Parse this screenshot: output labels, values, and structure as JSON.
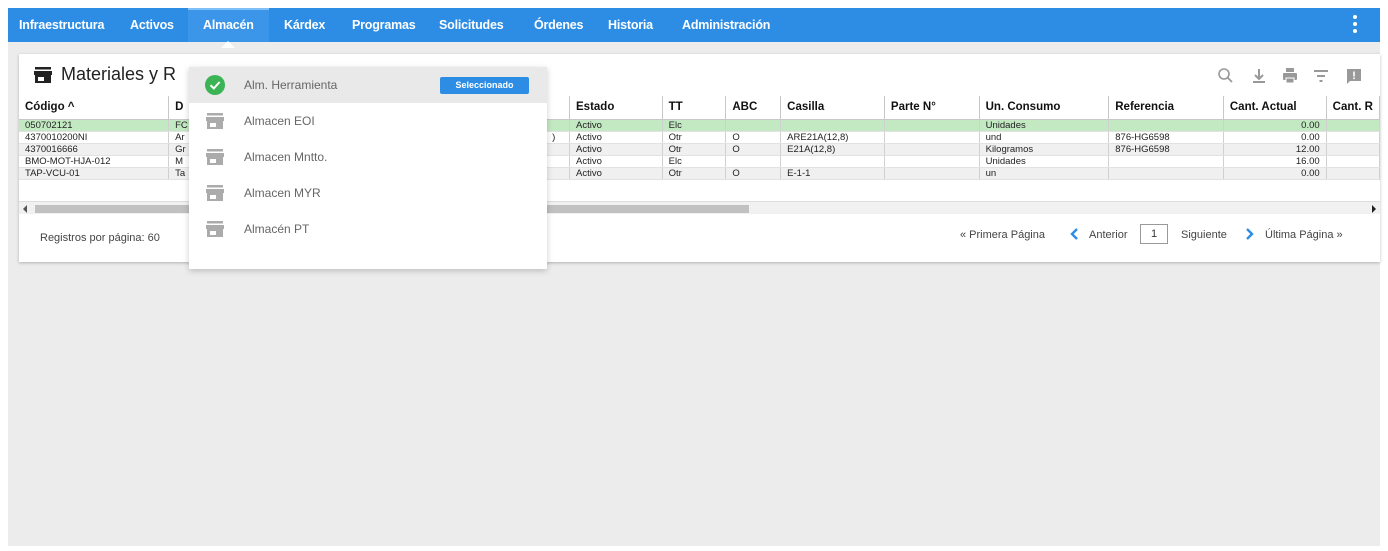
{
  "nav": {
    "items": [
      "Infraestructura",
      "Activos",
      "Almacén",
      "Kárdex",
      "Programas",
      "Solicitudes",
      "Órdenes",
      "Historia",
      "Administración"
    ],
    "active": "Almacén"
  },
  "card": {
    "title": "Materiales y R",
    "columns": [
      "Código ^",
      "D",
      "",
      "Estado",
      "TT",
      "ABC",
      "Casilla",
      "Parte N°",
      "Un. Consumo",
      "Referencia",
      "Cant. Actual",
      "Cant. R"
    ],
    "rows": [
      [
        "050702121",
        "FC",
        "",
        "Activo",
        "Elc",
        "",
        "",
        "",
        "Unidades",
        "",
        "0.00",
        ""
      ],
      [
        "4370010200NI",
        "Ar",
        ")",
        "Activo",
        "Otr",
        "O",
        "ARE21A(12,8)",
        "",
        "und",
        "876-HG6598",
        "0.00",
        ""
      ],
      [
        "4370016666",
        "Gr",
        "",
        "Activo",
        "Otr",
        "O",
        "E21A(12,8)",
        "",
        "Kilogramos",
        "876-HG6598",
        "12.00",
        ""
      ],
      [
        "BMO-MOT-HJA-012",
        "M",
        "",
        "Activo",
        "Elc",
        "",
        "",
        "",
        "Unidades",
        "",
        "16.00",
        ""
      ],
      [
        "TAP-VCU-01",
        "Ta",
        "",
        "Activo",
        "Otr",
        "O",
        "E-1-1",
        "",
        "un",
        "",
        "0.00",
        ""
      ]
    ],
    "records_per_page": "Registros por página: 60",
    "pager": {
      "first": "« Primera Página",
      "prev": "Anterior",
      "page": "1",
      "next": "Siguiente",
      "last": "Última Página »"
    }
  },
  "dropdown": {
    "items": [
      {
        "label": "Alm. Herramienta",
        "selected": true,
        "badge": "Seleccionado"
      },
      {
        "label": "Almacen EOI"
      },
      {
        "label": "Almacen Mntto."
      },
      {
        "label": "Almacen MYR"
      },
      {
        "label": "Almacén PT"
      }
    ]
  },
  "colors": {
    "nav": "#2d8de5",
    "selected_row": "#c3e9c3",
    "check": "#3cb354",
    "badge": "#2d8de5"
  }
}
